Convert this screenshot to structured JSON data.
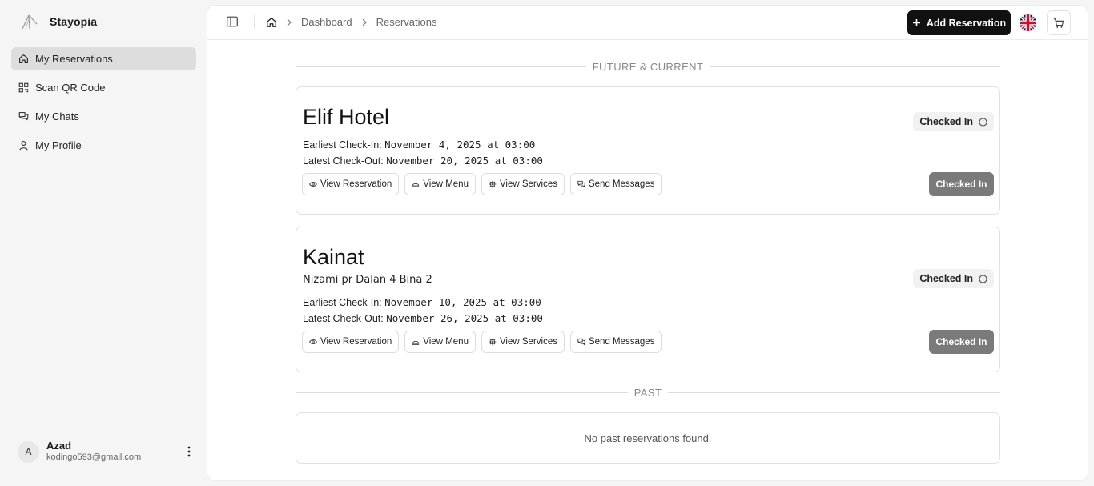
{
  "app": {
    "name": "Stayopia"
  },
  "sidebar": {
    "items": [
      {
        "label": "My Reservations",
        "icon": "home-icon",
        "active": true
      },
      {
        "label": "Scan QR Code",
        "icon": "qr-icon"
      },
      {
        "label": "My Chats",
        "icon": "chats-icon"
      },
      {
        "label": "My Profile",
        "icon": "user-icon"
      }
    ],
    "user": {
      "initial": "A",
      "name": "Azad",
      "email": "kodingo593@gmail.com"
    }
  },
  "header": {
    "breadcrumb": [
      "Dashboard",
      "Reservations"
    ],
    "add_label": "Add Reservation",
    "language": "en-GB"
  },
  "sections": {
    "future": "FUTURE & CURRENT",
    "past": "PAST"
  },
  "reservations": [
    {
      "name": "Elif Hotel",
      "address": "",
      "checkin_label": "Earliest Check-In:",
      "checkin": "November 4, 2025 at 03:00",
      "checkout_label": "Latest Check-Out:",
      "checkout": "November 20, 2025 at 03:00",
      "status": "Checked In",
      "status_button": "Checked In"
    },
    {
      "name": "Kainat",
      "address": "Nizami pr Dalan 4 Bina 2",
      "checkin_label": "Earliest Check-In:",
      "checkin": "November 10, 2025 at 03:00",
      "checkout_label": "Latest Check-Out:",
      "checkout": "November 26, 2025 at 03:00",
      "status": "Checked In",
      "status_button": "Checked In"
    }
  ],
  "actions": {
    "view_reservation": "View Reservation",
    "view_menu": "View Menu",
    "view_services": "View Services",
    "send_messages": "Send Messages"
  },
  "past": {
    "empty_text": "No past reservations found."
  },
  "colors": {
    "primary": "#111111",
    "status_button": "#7a7a7a",
    "active_nav": "#dddddd"
  }
}
